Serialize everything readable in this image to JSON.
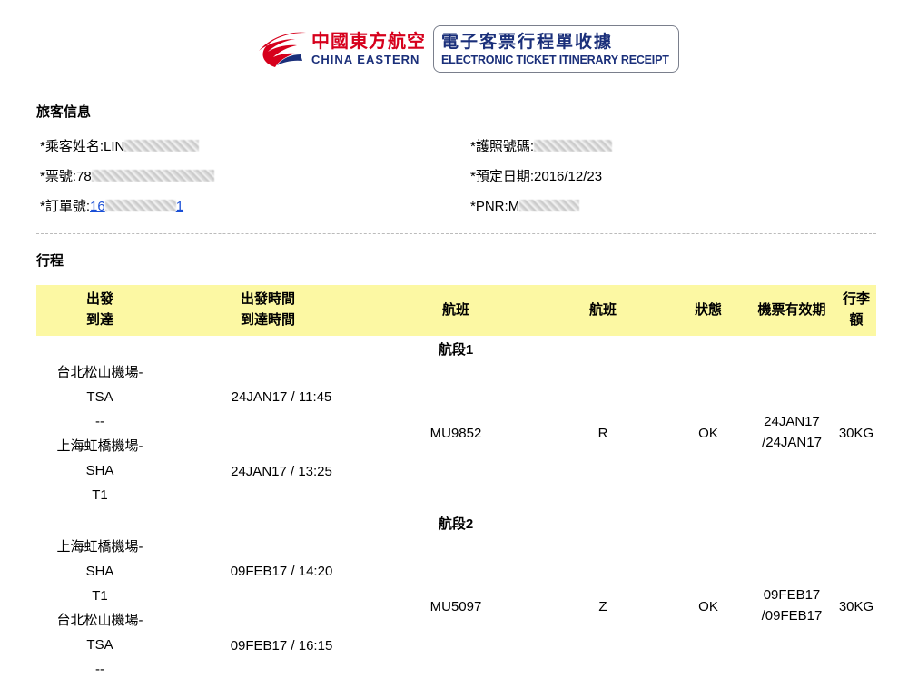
{
  "header": {
    "airline_cn": "中國東方航空",
    "airline_en": "CHINA EASTERN",
    "receipt_cn": "電子客票行程單收據",
    "receipt_en": "ELECTRONIC TICKET ITINERARY RECEIPT",
    "colors": {
      "brand_red": "#d6001c",
      "brand_blue": "#1a2f7a"
    }
  },
  "passenger": {
    "section_title": "旅客信息",
    "name_label": "*乘客姓名:",
    "name_value": "LIN",
    "ticket_label": "*票號:",
    "ticket_value": "78",
    "order_label": "*訂單號:",
    "order_value_prefix": "16",
    "order_value_suffix": "1",
    "passport_label": "*護照號碼:",
    "booking_date_label": "*預定日期:",
    "booking_date_value": "2016/12/23",
    "pnr_label": "*PNR:",
    "pnr_value": "M"
  },
  "itinerary": {
    "section_title": "行程",
    "headers": {
      "depart": "出發",
      "arrive": "到達",
      "depart_time": "出發時間",
      "arrive_time": "到達時間",
      "flight": "航班",
      "class": "航班",
      "status": "狀態",
      "validity": "機票有效期",
      "baggage_1": "行李",
      "baggage_2": "額"
    },
    "segments": [
      {
        "title": "航段1",
        "from_airport": "台北松山機場-",
        "from_code": "TSA",
        "from_terminal": "--",
        "to_airport": "上海虹橋機場-",
        "to_code": "SHA",
        "to_terminal": "T1",
        "depart_time": "24JAN17 / 11:45",
        "arrive_time": "24JAN17 / 13:25",
        "flight": "MU9852",
        "class": "R",
        "status": "OK",
        "validity_1": "24JAN17",
        "validity_2": "/24JAN17",
        "baggage": "30KG"
      },
      {
        "title": "航段2",
        "from_airport": "上海虹橋機場-",
        "from_code": "SHA",
        "from_terminal": "T1",
        "to_airport": "台北松山機場-",
        "to_code": "TSA",
        "to_terminal": "--",
        "depart_time": "09FEB17 / 14:20",
        "arrive_time": "09FEB17 / 16:15",
        "flight": "MU5097",
        "class": "Z",
        "status": "OK",
        "validity_1": "09FEB17",
        "validity_2": "/09FEB17",
        "baggage": "30KG"
      }
    ]
  }
}
